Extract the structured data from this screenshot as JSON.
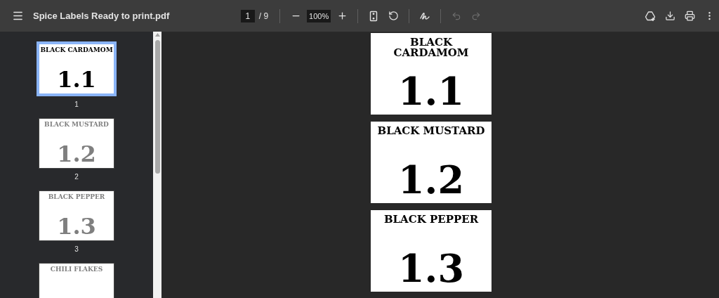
{
  "toolbar": {
    "title": "Spice Labels Ready to print.pdf",
    "page_field": "1",
    "page_total": "/ 9",
    "zoom": "100%",
    "undo": {
      "disabled": true
    },
    "redo": {
      "disabled": true
    }
  },
  "thumbnails": [
    {
      "title": "BLACK CARDAMOM",
      "number": "1.1",
      "label": "1",
      "selected": true
    },
    {
      "title": "BLACK MUSTARD",
      "number": "1.2",
      "label": "2",
      "selected": false
    },
    {
      "title": "BLACK PEPPER",
      "number": "1.3",
      "label": "3",
      "selected": false
    },
    {
      "title": "CHILI FLAKES",
      "selected": false
    }
  ],
  "pages": [
    {
      "title": "BLACK CARDAMOM",
      "number": "1.1"
    },
    {
      "title": "BLACK MUSTARD",
      "number": "1.2"
    },
    {
      "title": "BLACK PEPPER",
      "number": "1.3"
    }
  ]
}
